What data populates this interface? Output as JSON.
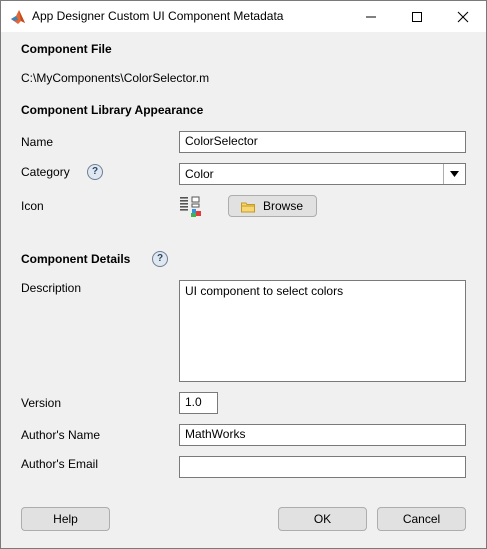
{
  "window": {
    "title": "App Designer Custom UI Component Metadata"
  },
  "component_file": {
    "heading": "Component File",
    "path": "C:\\MyComponents\\ColorSelector.m"
  },
  "library_appearance": {
    "heading": "Component Library Appearance",
    "name_label": "Name",
    "name_value": "ColorSelector",
    "category_label": "Category",
    "category_value": "Color",
    "icon_label": "Icon",
    "browse_label": "Browse"
  },
  "details": {
    "heading": "Component Details",
    "description_label": "Description",
    "description_value": "UI component to select colors",
    "version_label": "Version",
    "version_value": "1.0",
    "author_name_label": "Author's Name",
    "author_name_value": "MathWorks",
    "author_email_label": "Author's Email",
    "author_email_value": ""
  },
  "help_glyph": "?",
  "footer": {
    "help_label": "Help",
    "ok_label": "OK",
    "cancel_label": "Cancel"
  }
}
